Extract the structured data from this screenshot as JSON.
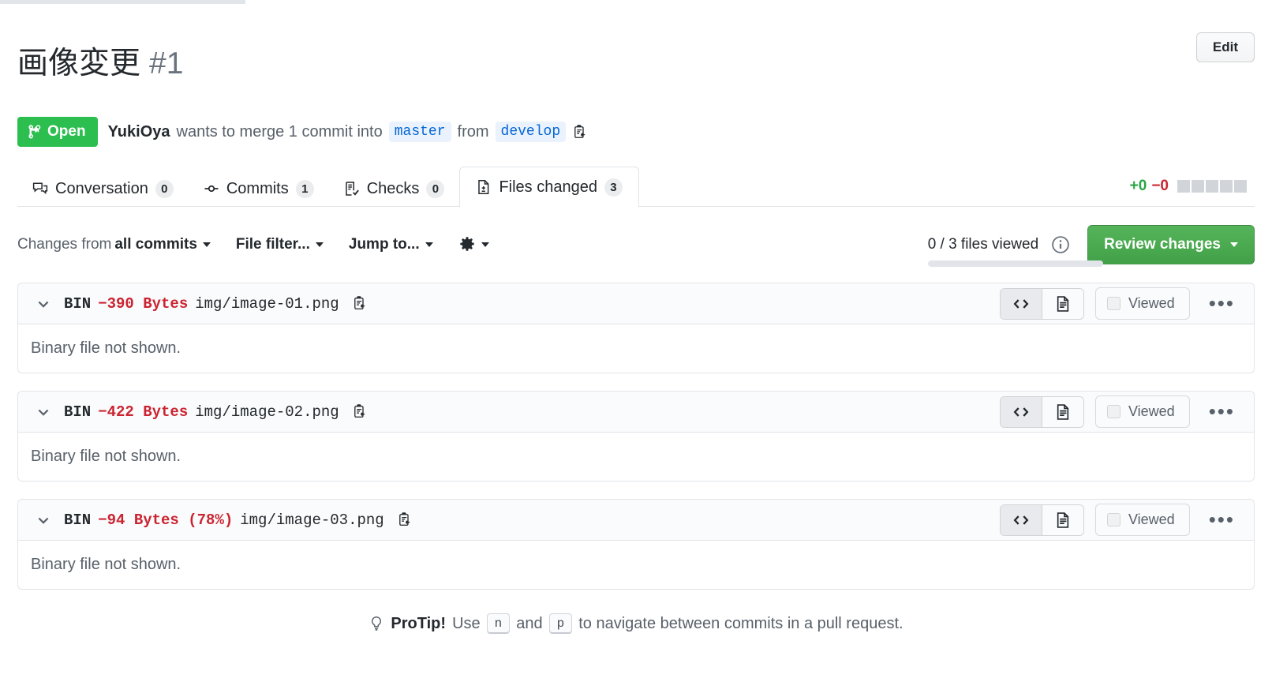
{
  "header": {
    "title": "画像変更",
    "number": "#1",
    "edit_label": "Edit",
    "state": "Open",
    "author": "YukiOya",
    "merge_text_before": "wants to merge 1 commit into",
    "base_branch": "master",
    "merge_text_middle": "from",
    "head_branch": "develop"
  },
  "tabs": [
    {
      "label": "Conversation",
      "count": "0",
      "icon": "comment-discussion-icon",
      "active": false
    },
    {
      "label": "Commits",
      "count": "1",
      "icon": "git-commit-icon",
      "active": false
    },
    {
      "label": "Checks",
      "count": "0",
      "icon": "checklist-icon",
      "active": false
    },
    {
      "label": "Files changed",
      "count": "3",
      "icon": "diff-file-icon",
      "active": true
    }
  ],
  "diffstat": {
    "additions": "+0",
    "deletions": "−0",
    "blocks": 5
  },
  "toolbar": {
    "changes_from_prefix": "Changes from",
    "changes_from_value": "all commits",
    "file_filter": "File filter...",
    "jump_to": "Jump to...",
    "gear": "gear-icon",
    "files_viewed": "0 / 3 files viewed",
    "progress_percent": 0,
    "review_changes": "Review changes"
  },
  "files": [
    {
      "mode": "BIN",
      "bytes": "−390 Bytes",
      "path": "img/image-01.png",
      "body": "Binary file not shown.",
      "viewed_label": "Viewed",
      "viewed_checked": false
    },
    {
      "mode": "BIN",
      "bytes": "−422 Bytes",
      "path": "img/image-02.png",
      "body": "Binary file not shown.",
      "viewed_label": "Viewed",
      "viewed_checked": false
    },
    {
      "mode": "BIN",
      "bytes": "−94 Bytes (78%)",
      "path": "img/image-03.png",
      "body": "Binary file not shown.",
      "viewed_label": "Viewed",
      "viewed_checked": false
    }
  ],
  "protip": {
    "lead": "ProTip!",
    "text_1": "Use",
    "key_1": "n",
    "text_2": "and",
    "key_2": "p",
    "text_3": "to navigate between commits in a pull request."
  },
  "colors": {
    "open_green": "#2cbe4e",
    "button_green": "#42a148",
    "deletion_red": "#cb2431",
    "addition_green": "#28a745",
    "branch_blue": "#0366d6",
    "border": "#e1e4e8"
  }
}
